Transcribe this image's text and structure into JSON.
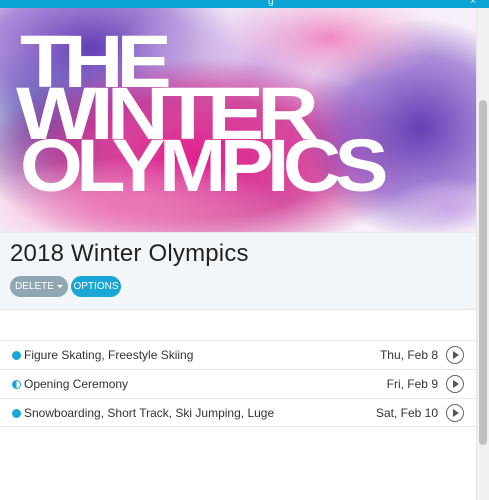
{
  "hero": {
    "line1": "THE",
    "line2": "WINTER",
    "line3": "OLYMPICS"
  },
  "event": {
    "title": "2018 Winter Olympics",
    "delete_label": "DELETE",
    "options_label": "OPTIONS"
  },
  "schedule": [
    {
      "label": "Figure Skating, Freestyle Skiing",
      "date": "Thu, Feb 8",
      "indicator": "full"
    },
    {
      "label": "Opening Ceremony",
      "date": "Fri, Feb 9",
      "indicator": "half"
    },
    {
      "label": "Snowboarding, Short Track, Ski Jumping, Luge",
      "date": "Sat, Feb 10",
      "indicator": "full"
    }
  ],
  "colors": {
    "accent": "#1aa6d6",
    "delete_button": "#8fa6b3",
    "topbar": "#0ba3d4",
    "hero_magenta": "#d4127e",
    "hero_purple": "#6a3bb5"
  },
  "icons": {
    "row_indicator": "circle-dot-icon",
    "row_action": "play-circle-icon",
    "delete_caret": "caret-down-icon"
  }
}
